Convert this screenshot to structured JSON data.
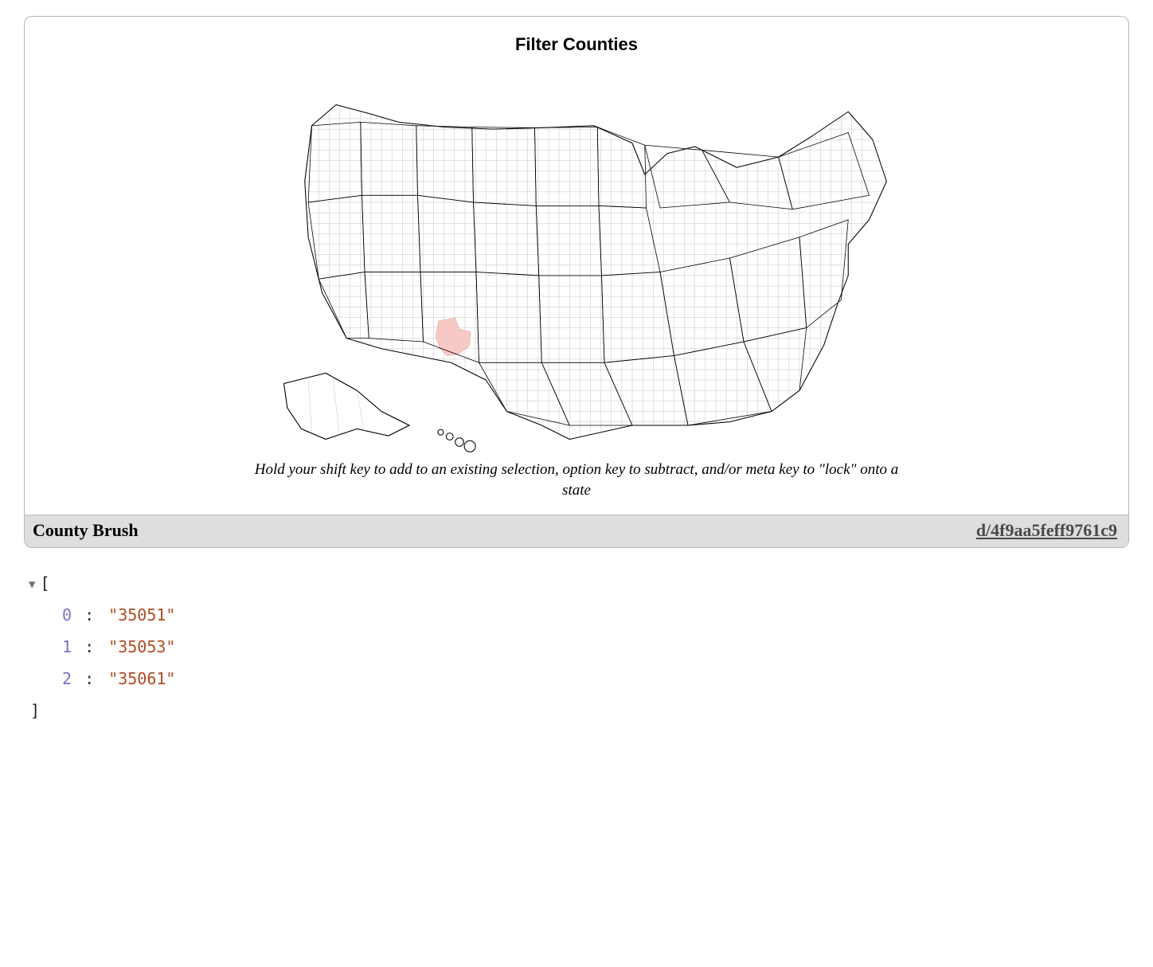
{
  "card": {
    "title": "Filter Counties",
    "hint": "Hold your shift key to add to an existing selection, option key to subtract, and/or meta key to \"lock\" onto a state",
    "footer_title": "County Brush",
    "footer_link": "d/4f9aa5feff9761c9"
  },
  "output_array": {
    "expanded": true,
    "items": [
      {
        "index": 0,
        "value": "35051"
      },
      {
        "index": 1,
        "value": "35053"
      },
      {
        "index": 2,
        "value": "35061"
      }
    ]
  },
  "map": {
    "selected_state_code": "35",
    "selected_county_count": 3,
    "highlight_color": "#f6c9c5"
  }
}
